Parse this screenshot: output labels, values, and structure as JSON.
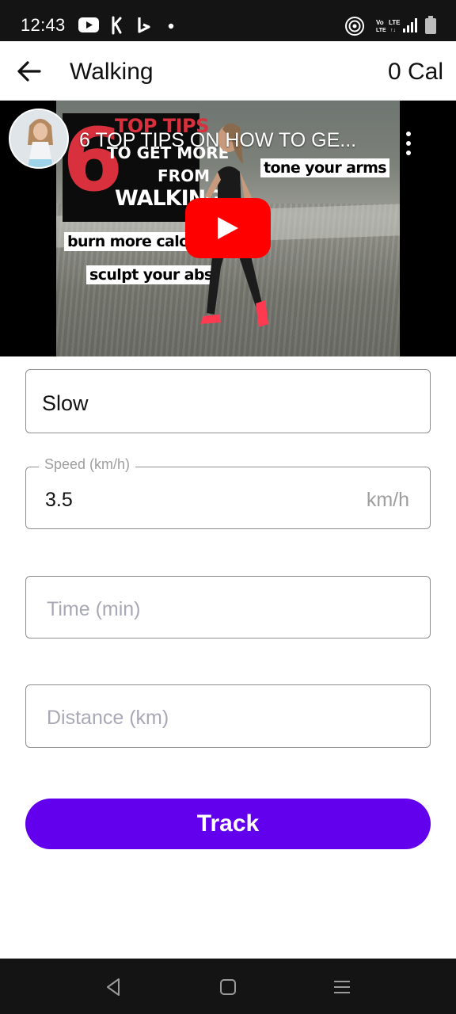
{
  "status_bar": {
    "time": "12:43",
    "icons": [
      "youtube-icon",
      "app-k-icon",
      "bing-icon",
      "dot-icon",
      "hotspot-icon",
      "volte-icon",
      "signal-icon",
      "battery-icon"
    ]
  },
  "app_bar": {
    "back_icon": "arrow-left-icon",
    "title": "Walking",
    "calories": "0 Cal"
  },
  "video": {
    "title": "6 TOP TIPS ON HOW TO GE...",
    "thumbnail_text": {
      "number": "6",
      "top_tips": "TOP TIPS",
      "to_get_more": "TO GET MORE",
      "from": "FROM",
      "walking": "WALKING",
      "tone": "tone your arms",
      "burn": "burn more calor",
      "sculpt": "sculpt your abs"
    },
    "play_icon": "youtube-play-icon",
    "menu_icon": "more-vertical-icon"
  },
  "form": {
    "intensity": {
      "value": "Slow"
    },
    "speed": {
      "label": "Speed (km/h)",
      "value": "3.5",
      "suffix": "km/h"
    },
    "time": {
      "placeholder": "Time (min)"
    },
    "distance": {
      "placeholder": "Distance (km)"
    },
    "track_button": "Track"
  },
  "colors": {
    "primary": "#6200ee",
    "youtube_red": "#ff0000",
    "system_bar": "#141414",
    "field_border": "#8e8e8e",
    "placeholder": "#a8a8b6"
  },
  "nav_bar": {
    "icons": [
      "nav-back-icon",
      "nav-home-icon",
      "nav-recents-icon"
    ]
  }
}
